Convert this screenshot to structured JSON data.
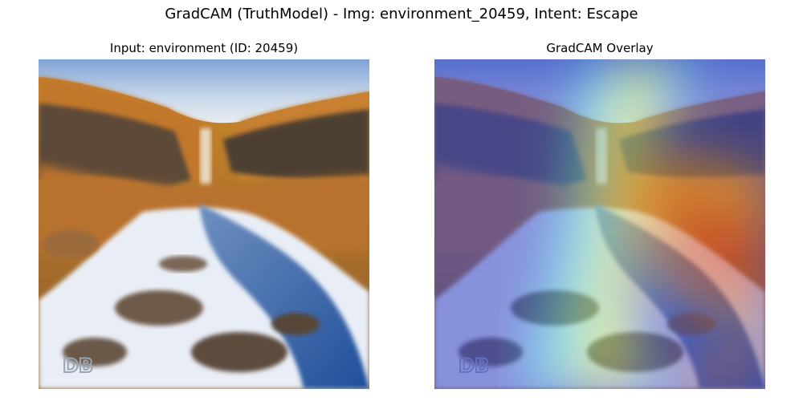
{
  "figure": {
    "suptitle": "GradCAM (TruthModel) - Img: environment_20459, Intent: Escape"
  },
  "panels": [
    {
      "title": "Input: environment (ID: 20459)",
      "content": "landscape-photo"
    },
    {
      "title": "GradCAM Overlay",
      "content": "landscape-photo-with-heatmap"
    }
  ],
  "watermark": {
    "text": "DB"
  },
  "colors": {
    "sky": "#a9c6e6",
    "autumn_grass": "#c07a2a",
    "cliff_rock": "#5a4632",
    "snow": "#eef2f8",
    "river": "#3f6aa8",
    "heatmap_cold": "#3a4fd8",
    "heatmap_hot": "#c8402a"
  }
}
